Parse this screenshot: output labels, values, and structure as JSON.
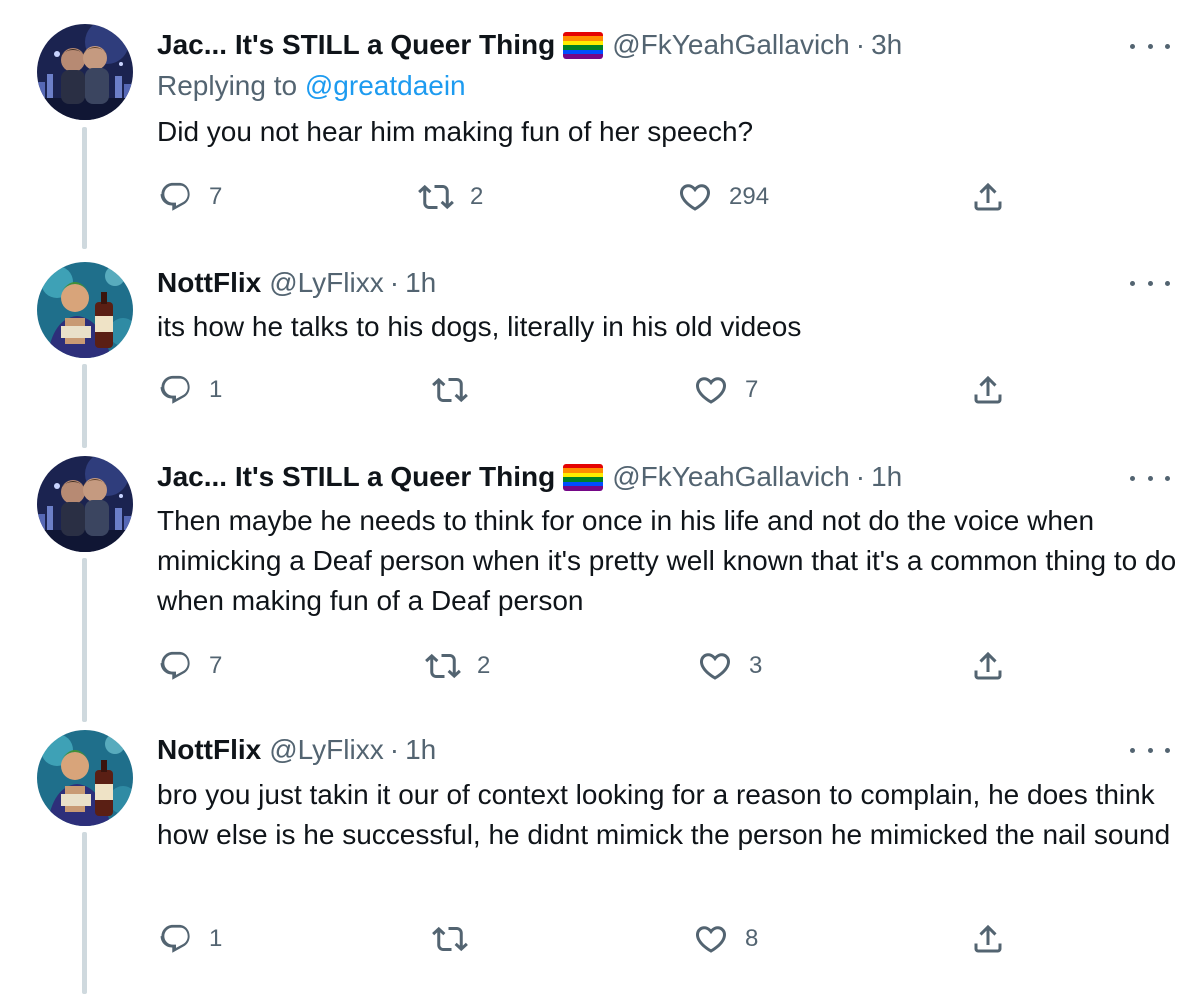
{
  "tweets": [
    {
      "name": "Jac... It's STILL a Queer Thing",
      "handle": "@FkYeahGallavich",
      "sep": "·",
      "time": "3h",
      "replying_label": "Replying to",
      "replying_to": "@greatdaein",
      "text": "Did you not hear him making fun of her speech?",
      "replies": "7",
      "retweets": "2",
      "likes": "294",
      "avatar": "couple-city-night-avatar",
      "flag": "rainbow-flag-emoji"
    },
    {
      "name": "NottFlix",
      "handle": "@LyFlixx",
      "sep": "·",
      "time": "1h",
      "text": "its how he talks to his dogs, literally in his old videos",
      "replies": "1",
      "retweets": "",
      "likes": "7",
      "avatar": "anime-swordsman-avatar"
    },
    {
      "name": "Jac... It's STILL a Queer Thing",
      "handle": "@FkYeahGallavich",
      "sep": "·",
      "time": "1h",
      "text": "Then maybe he needs to think for once in his life and not do the voice when mimicking a Deaf person when it's pretty well known that it's a common thing to do when making fun of a Deaf person",
      "replies": "7",
      "retweets": "2",
      "likes": "3",
      "avatar": "couple-city-night-avatar",
      "flag": "rainbow-flag-emoji"
    },
    {
      "name": "NottFlix",
      "handle": "@LyFlixx",
      "sep": "·",
      "time": "1h",
      "text": "bro you just takin it our of context looking for a reason to complain, he does think how else is he successful, he didnt mimick the person he mimicked the nail sound",
      "replies": "1",
      "retweets": "",
      "likes": "8",
      "avatar": "anime-swordsman-avatar"
    }
  ],
  "colors": {
    "text": "#0f1419",
    "secondary": "#536471",
    "link": "#1d9bf0",
    "thread_line": "#cfd9de",
    "rainbow": [
      "#e40303",
      "#ff8c00",
      "#ffed00",
      "#008026",
      "#004dff",
      "#750787"
    ]
  },
  "icons": [
    "reply-icon",
    "retweet-icon",
    "like-icon",
    "share-icon",
    "more-icon"
  ]
}
